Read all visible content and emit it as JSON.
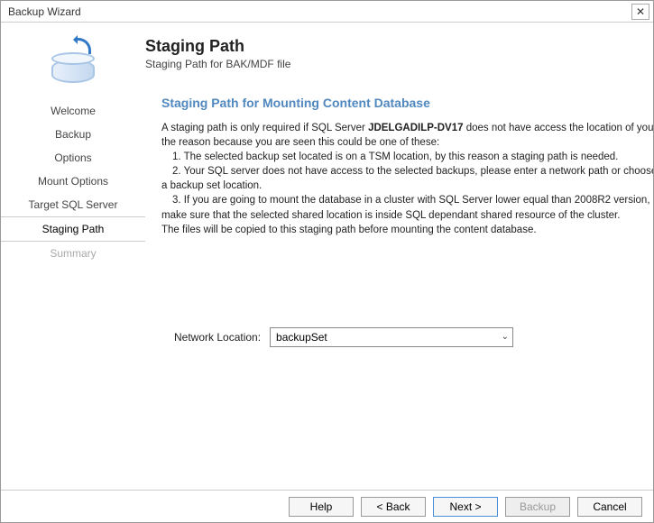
{
  "window": {
    "title": "Backup Wizard"
  },
  "header": {
    "title": "Staging Path",
    "subtitle": "Staging Path for BAK/MDF file"
  },
  "steps": {
    "items": [
      {
        "label": "Welcome"
      },
      {
        "label": "Backup"
      },
      {
        "label": "Options"
      },
      {
        "label": "Mount Options"
      },
      {
        "label": "Target SQL Server"
      },
      {
        "label": "Staging Path"
      },
      {
        "label": "Summary"
      }
    ]
  },
  "section": {
    "title": "Staging Path for Mounting Content Database"
  },
  "desc": {
    "line1a": "A staging path is only required if SQL Server ",
    "server": "JDELGADILP-DV17",
    "line1b": " does not have access the location of your ba",
    "line2": "the reason because you are seen this could be one of these:",
    "bullet1": "1. The selected backup set located is on a TSM location, by this reason a staging path is needed.",
    "bullet2": "2. Your SQL server does not have access to the selected backups, please enter a network path or choose",
    "bullet2b": "a backup set location.",
    "bullet3": "3. If you are going to mount the database in a cluster with SQL Server lower equal than 2008R2 version,",
    "bullet3b": "make sure that the selected shared location is inside SQL dependant shared resource of the cluster.",
    "line3": "The files will be copied to this staging path before mounting the content database."
  },
  "form": {
    "network_label": "Network Location:",
    "network_value": "backupSet"
  },
  "buttons": {
    "help": "Help",
    "back": "< Back",
    "next": "Next >",
    "backup": "Backup",
    "cancel": "Cancel"
  }
}
